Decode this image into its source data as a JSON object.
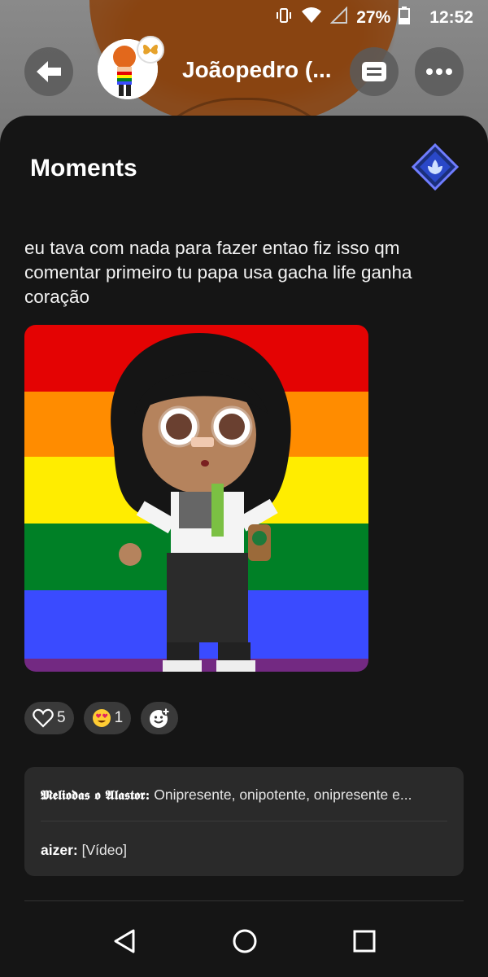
{
  "status_bar": {
    "battery": "27%",
    "time": "12:52",
    "icons": [
      "vibrate-icon",
      "wifi-icon",
      "signal-icon",
      "battery-icon"
    ]
  },
  "header": {
    "user_name": "Joãopedro (...",
    "badge_icon": "butterfly-icon"
  },
  "panel": {
    "title": "Moments",
    "post_text": "eu tava com nada para fazer entao fiz isso qm comentar primeiro tu papa usa gacha life ganha coração"
  },
  "reactions": {
    "likes": "5",
    "emoji_count": "1"
  },
  "comments": [
    {
      "author": "𝕸𝖊𝖑𝖎𝖔𝖉𝖆𝖘 𝖔 𝕬𝖑𝖆𝖘𝖙𝖔𝖗:",
      "text": " Onipresente, onipotente, onipresente e..."
    },
    {
      "author": "aizer:",
      "text": " [Vídeo]"
    }
  ],
  "colors": {
    "panel_bg": "#151515",
    "pill_bg": "#3a3a3a",
    "comment_bg": "#2a2a2a",
    "flag": [
      "#e40303",
      "#ff8c00",
      "#ffed00",
      "#008026",
      "#3a4bff",
      "#732982"
    ]
  }
}
